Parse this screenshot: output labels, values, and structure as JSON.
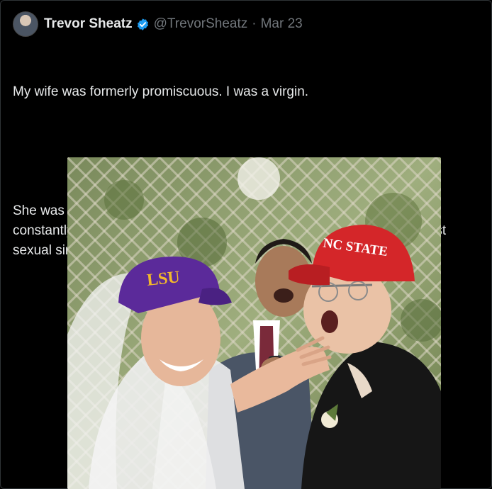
{
  "tweet": {
    "author_name": "Trevor Sheatz",
    "handle": "@TrevorSheatz",
    "separator": "·",
    "date": "Mar 23",
    "paragraph1": "My wife was formerly promiscuous. I was a virgin.",
    "paragraph2": "She was then radically born-again. Committed to church, evangelized constantly, Puritan books in her bedroom, prayer journals, grief over past sexual sin, etc...."
  },
  "photo": {
    "cap_left_text": "LSU",
    "cap_right_text": "NC STATE"
  },
  "colors": {
    "background": "#000000",
    "text": "#e7e9ea",
    "muted": "#71767b",
    "verified_blue": "#1d9bf0"
  }
}
